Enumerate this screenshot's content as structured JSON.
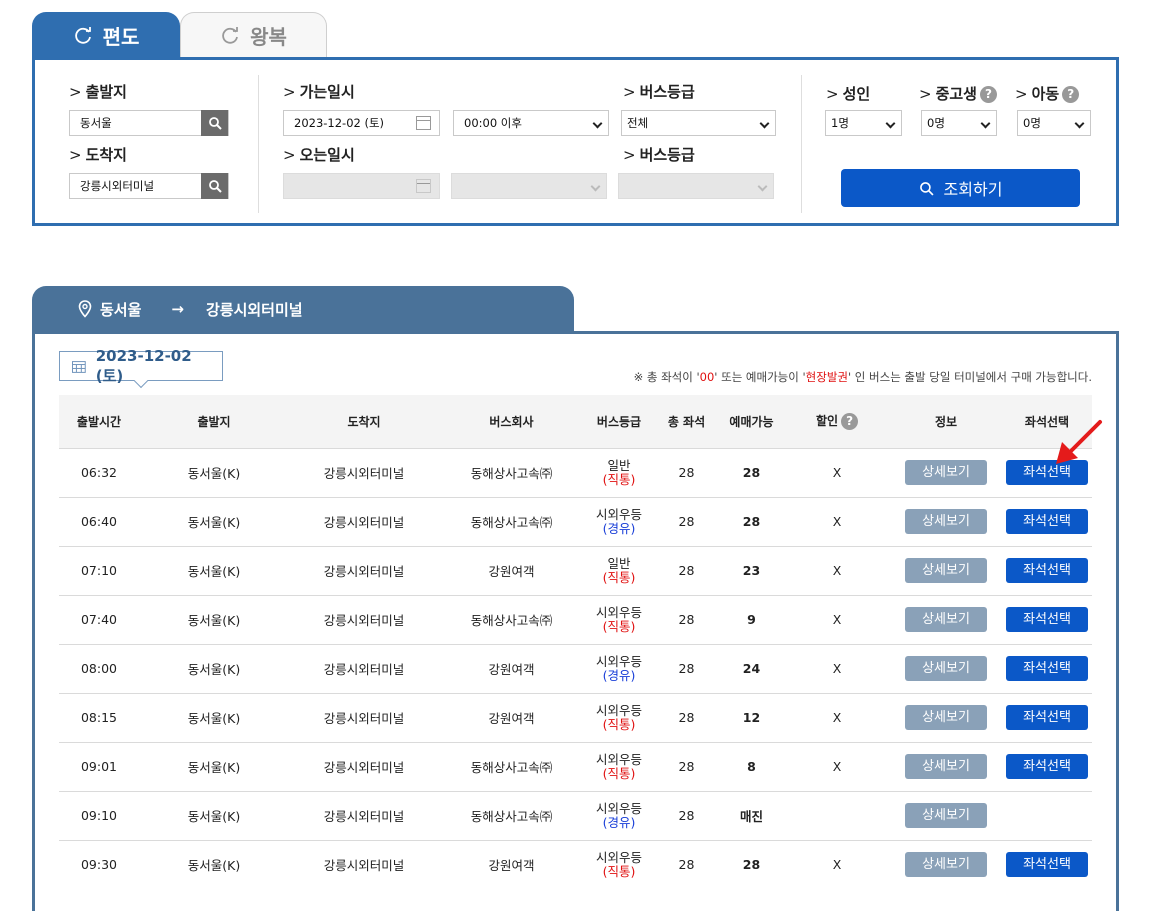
{
  "tabs": {
    "oneway": "편도",
    "round": "왕복"
  },
  "search": {
    "departure_label": "출발지",
    "departure_value": "동서울",
    "arrival_label": "도착지",
    "arrival_value": "강릉시외터미널",
    "go_date_label": "가는일시",
    "go_date_value": "2023-12-02 (토)",
    "go_time_value": "00:00 이후",
    "bus_grade_label": "버스등급",
    "bus_grade_value": "전체",
    "return_date_label": "오는일시",
    "return_bus_grade_label": "버스등급",
    "adult_label": "성인",
    "adult_value": "1명",
    "student_label": "중고생",
    "student_value": "0명",
    "child_label": "아동",
    "child_value": "0명",
    "help_glyph": "?",
    "submit_label": "조회하기"
  },
  "route": {
    "from": "동서울",
    "arrow": "→",
    "to": "강릉시외터미널"
  },
  "result": {
    "date": "2023-12-02 (토)",
    "notice_prefix": "※ 총 좌석이 '",
    "notice_zero": "00",
    "notice_mid": "' 또는 예매가능이 '",
    "notice_onsite": "현장발권",
    "notice_suffix": "' 인 버스는 출발 당일 터미널에서 구매 가능합니다."
  },
  "table": {
    "headers": [
      "출발시간",
      "출발지",
      "도착지",
      "버스회사",
      "버스등급",
      "총 좌석",
      "예매가능",
      "할인",
      "정보",
      "좌석선택"
    ],
    "detail_label": "상세보기",
    "seat_label": "좌석선택",
    "rows": [
      {
        "time": "06:32",
        "from": "동서울(K)",
        "to": "강릉시외터미널",
        "company": "동해상사고속㈜",
        "grade": "일반",
        "route_type": "(직통)",
        "route_color": "red",
        "total": "28",
        "avail": "28",
        "discount": "X",
        "seat_button": true
      },
      {
        "time": "06:40",
        "from": "동서울(K)",
        "to": "강릉시외터미널",
        "company": "동해상사고속㈜",
        "grade": "시외우등",
        "route_type": "(경유)",
        "route_color": "blue",
        "total": "28",
        "avail": "28",
        "discount": "X",
        "seat_button": true
      },
      {
        "time": "07:10",
        "from": "동서울(K)",
        "to": "강릉시외터미널",
        "company": "강원여객",
        "grade": "일반",
        "route_type": "(직통)",
        "route_color": "red",
        "total": "28",
        "avail": "23",
        "discount": "X",
        "seat_button": true
      },
      {
        "time": "07:40",
        "from": "동서울(K)",
        "to": "강릉시외터미널",
        "company": "동해상사고속㈜",
        "grade": "시외우등",
        "route_type": "(직통)",
        "route_color": "red",
        "total": "28",
        "avail": "9",
        "discount": "X",
        "seat_button": true
      },
      {
        "time": "08:00",
        "from": "동서울(K)",
        "to": "강릉시외터미널",
        "company": "강원여객",
        "grade": "시외우등",
        "route_type": "(경유)",
        "route_color": "blue",
        "total": "28",
        "avail": "24",
        "discount": "X",
        "seat_button": true
      },
      {
        "time": "08:15",
        "from": "동서울(K)",
        "to": "강릉시외터미널",
        "company": "강원여객",
        "grade": "시외우등",
        "route_type": "(직통)",
        "route_color": "red",
        "total": "28",
        "avail": "12",
        "discount": "X",
        "seat_button": true
      },
      {
        "time": "09:01",
        "from": "동서울(K)",
        "to": "강릉시외터미널",
        "company": "동해상사고속㈜",
        "grade": "시외우등",
        "route_type": "(직통)",
        "route_color": "red",
        "total": "28",
        "avail": "8",
        "discount": "X",
        "seat_button": true
      },
      {
        "time": "09:10",
        "from": "동서울(K)",
        "to": "강릉시외터미널",
        "company": "동해상사고속㈜",
        "grade": "시외우등",
        "route_type": "(경유)",
        "route_color": "blue",
        "total": "28",
        "avail": "매진",
        "discount": "",
        "seat_button": false
      },
      {
        "time": "09:30",
        "from": "동서울(K)",
        "to": "강릉시외터미널",
        "company": "강원여객",
        "grade": "시외우등",
        "route_type": "(직통)",
        "route_color": "red",
        "total": "28",
        "avail": "28",
        "discount": "X",
        "seat_button": true
      }
    ]
  },
  "colors": {
    "primary": "#2f6eb0",
    "route_header": "#4a7299",
    "button_blue": "#0b58c8",
    "button_grey": "#8aa1b8",
    "direct_red": "#e01010",
    "via_blue": "#1a3fd8"
  }
}
